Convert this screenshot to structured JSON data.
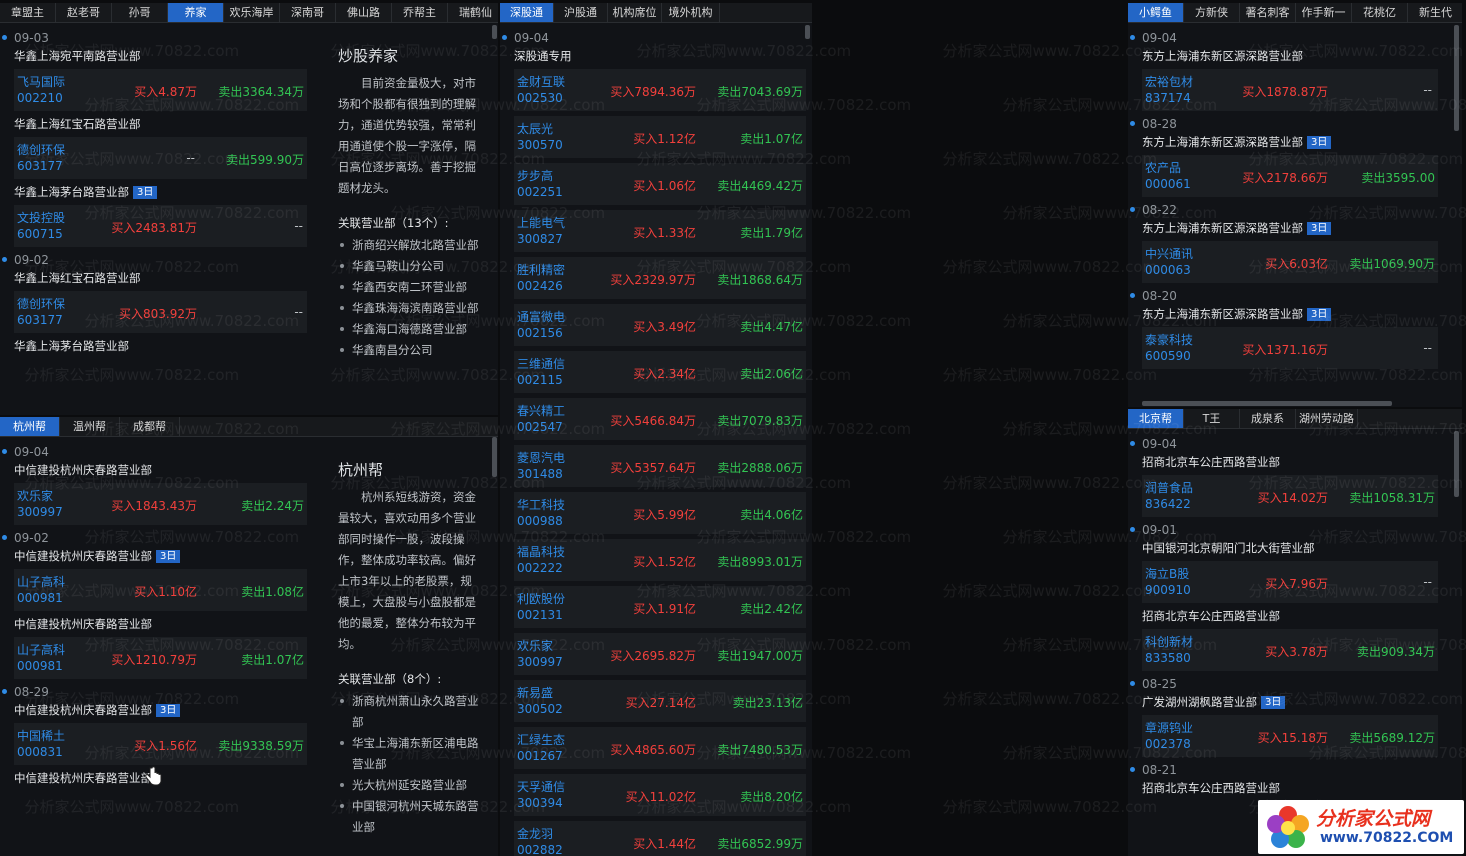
{
  "p1": {
    "tabs": [
      "章盟主",
      "赵老哥",
      "孙哥",
      "养家",
      "欢乐海岸",
      "深南哥",
      "佛山路",
      "乔帮主",
      "瑞鹤仙"
    ],
    "active": 3,
    "feed": [
      {
        "date": "09-03"
      },
      {
        "branch": "华鑫上海宛平南路营业部"
      },
      {
        "name": "飞马国际",
        "code": "002210",
        "buy": "买入4.87万",
        "sell": "卖出3364.34万"
      },
      {
        "branch": "华鑫上海红宝石路营业部"
      },
      {
        "name": "德创环保",
        "code": "603177",
        "buy": "--",
        "sell": "卖出599.90万"
      },
      {
        "branch": "华鑫上海茅台路营业部",
        "badge": "3日"
      },
      {
        "name": "文投控股",
        "code": "600715",
        "buy": "买入2483.81万",
        "sell": "--"
      },
      {
        "date": "09-02"
      },
      {
        "branch": "华鑫上海红宝石路营业部"
      },
      {
        "name": "德创环保",
        "code": "603177",
        "buy": "买入803.92万",
        "sell": "--"
      },
      {
        "branch": "华鑫上海茅台路营业部"
      }
    ],
    "side": {
      "title": "炒股养家",
      "para": "目前资金量极大，对市场和个股都有很独到的理解力，通道优势较强，常常利用通道使个股一字涨停，隔日高位逐步离场。善于挖掘题材龙头。",
      "assoc": "关联营业部（13个）:",
      "items": [
        "浙商绍兴解放北路营业部",
        "华鑫马鞍山分公司",
        "华鑫西安南二环营业部",
        "华鑫珠海海滨南路营业部",
        "华鑫海口海德路营业部",
        "华鑫南昌分公司"
      ]
    }
  },
  "p2": {
    "tabs": [
      "杭州帮",
      "温州帮",
      "成都帮"
    ],
    "active": 0,
    "feed": [
      {
        "date": "09-04"
      },
      {
        "branch": "中信建投杭州庆春路营业部"
      },
      {
        "name": "欢乐家",
        "code": "300997",
        "buy": "买入1843.43万",
        "sell": "卖出2.24万"
      },
      {
        "date": "09-02"
      },
      {
        "branch": "中信建投杭州庆春路营业部",
        "badge": "3日"
      },
      {
        "name": "山子高科",
        "code": "000981",
        "buy": "买入1.10亿",
        "sell": "卖出1.08亿"
      },
      {
        "branch": "中信建投杭州庆春路营业部"
      },
      {
        "name": "山子高科",
        "code": "000981",
        "buy": "买入1210.79万",
        "sell": "卖出1.07亿"
      },
      {
        "date": "08-29"
      },
      {
        "branch": "中信建投杭州庆春路营业部",
        "badge": "3日"
      },
      {
        "name": "中国稀土",
        "code": "000831",
        "buy": "买入1.56亿",
        "sell": "卖出9338.59万"
      },
      {
        "branch": "中信建投杭州庆春路营业部"
      }
    ],
    "side": {
      "title": "杭州帮",
      "para": "杭州系短线游资，资金量较大，喜欢动用多个营业部同时操作一股，波段操作，整体成功率较高。偏好上市3年以上的老股票，规模上，大盘股与小盘股都是他的最爱，整体分布较为平均。",
      "assoc": "关联营业部（8个）:",
      "items": [
        "浙商杭州萧山永久路营业部",
        "华宝上海浦东新区浦电路营业部",
        "光大杭州延安路营业部",
        "中国银河杭州天城东路营业部"
      ]
    }
  },
  "p3": {
    "tabs": [
      "深股通",
      "沪股通",
      "机构席位",
      "境外机构"
    ],
    "active": 0,
    "feed": [
      {
        "date": "09-04"
      },
      {
        "branch": "深股通专用"
      },
      {
        "name": "金财互联",
        "code": "002530",
        "buy": "买入7894.36万",
        "sell": "卖出7043.69万"
      },
      {
        "name": "太辰光",
        "code": "300570",
        "buy": "买入1.12亿",
        "sell": "卖出1.07亿"
      },
      {
        "name": "步步高",
        "code": "002251",
        "buy": "买入1.06亿",
        "sell": "卖出4469.42万"
      },
      {
        "name": "上能电气",
        "code": "300827",
        "buy": "买入1.33亿",
        "sell": "卖出1.79亿"
      },
      {
        "name": "胜利精密",
        "code": "002426",
        "buy": "买入2329.97万",
        "sell": "卖出1868.64万"
      },
      {
        "name": "通富微电",
        "code": "002156",
        "buy": "买入3.49亿",
        "sell": "卖出4.47亿"
      },
      {
        "name": "三维通信",
        "code": "002115",
        "buy": "买入2.34亿",
        "sell": "卖出2.06亿"
      },
      {
        "name": "春兴精工",
        "code": "002547",
        "buy": "买入5466.84万",
        "sell": "卖出7079.83万"
      },
      {
        "name": "菱恩汽电",
        "code": "301488",
        "buy": "买入5357.64万",
        "sell": "卖出2888.06万"
      },
      {
        "name": "华工科技",
        "code": "000988",
        "buy": "买入5.99亿",
        "sell": "卖出4.06亿"
      },
      {
        "name": "福晶科技",
        "code": "002222",
        "buy": "买入1.52亿",
        "sell": "卖出8993.01万"
      },
      {
        "name": "利欧股份",
        "code": "002131",
        "buy": "买入1.91亿",
        "sell": "卖出2.42亿"
      },
      {
        "name": "欢乐家",
        "code": "300997",
        "buy": "买入2695.82万",
        "sell": "卖出1947.00万"
      },
      {
        "name": "新易盛",
        "code": "300502",
        "buy": "买入27.14亿",
        "sell": "卖出23.13亿"
      },
      {
        "name": "汇绿生态",
        "code": "001267",
        "buy": "买入4865.60万",
        "sell": "卖出7480.53万"
      },
      {
        "name": "天孚通信",
        "code": "300394",
        "buy": "买入11.02亿",
        "sell": "卖出8.20亿"
      },
      {
        "name": "金龙羽",
        "code": "002882",
        "buy": "买入1.44亿",
        "sell": "卖出6852.99万"
      }
    ]
  },
  "p4": {
    "tabs": [
      "小鳄鱼",
      "方新侠",
      "著名刺客",
      "作手新一",
      "花桃亿",
      "新生代"
    ],
    "active": 0,
    "feed": [
      {
        "date": "09-04"
      },
      {
        "branch": "东方上海浦东新区源深路营业部"
      },
      {
        "name": "宏裕包材",
        "code": "837174",
        "buy": "买入1878.87万",
        "sell": "--"
      },
      {
        "date": "08-28"
      },
      {
        "branch": "东方上海浦东新区源深路营业部",
        "badge": "3日"
      },
      {
        "name": "农产品",
        "code": "000061",
        "buy": "买入2178.66万",
        "sell": "卖出3595.00"
      },
      {
        "date": "08-22"
      },
      {
        "branch": "东方上海浦东新区源深路营业部",
        "badge": "3日"
      },
      {
        "name": "中兴通讯",
        "code": "000063",
        "buy": "买入6.03亿",
        "sell": "卖出1069.90万"
      },
      {
        "date": "08-20"
      },
      {
        "branch": "东方上海浦东新区源深路营业部",
        "badge": "3日"
      },
      {
        "name": "泰豪科技",
        "code": "600590",
        "buy": "买入1371.16万",
        "sell": "--"
      }
    ]
  },
  "p5": {
    "tabs": [
      "北京帮",
      "T王",
      "成泉系",
      "湖州劳动路"
    ],
    "active": 0,
    "feed": [
      {
        "date": "09-04"
      },
      {
        "branch": "招商北京车公庄西路营业部"
      },
      {
        "name": "润普食品",
        "code": "836422",
        "buy": "买入14.02万",
        "sell": "卖出1058.31万"
      },
      {
        "date": "09-01"
      },
      {
        "branch": "中国银河北京朝阳门北大街营业部"
      },
      {
        "name": "海立B股",
        "code": "900910",
        "buy": "买入7.96万",
        "sell": "--"
      },
      {
        "branch": "招商北京车公庄西路营业部"
      },
      {
        "name": "科创新材",
        "code": "833580",
        "buy": "买入3.78万",
        "sell": "卖出909.34万"
      },
      {
        "date": "08-25"
      },
      {
        "branch": "广发湖州湖枫路营业部",
        "badge": "3日"
      },
      {
        "name": "章源钨业",
        "code": "002378",
        "buy": "买入15.18万",
        "sell": "卖出5689.12万"
      },
      {
        "date": "08-21"
      },
      {
        "branch": "招商北京车公庄西路营业部"
      }
    ]
  },
  "watermark": "分析家公式网www.70822.com",
  "logo": {
    "title": "分析家公式网",
    "url": "www.70822.COM"
  },
  "colors": {
    "accent": "#2366c6",
    "buy": "#f2403c",
    "sell": "#32c453",
    "link": "#2f8be6"
  }
}
